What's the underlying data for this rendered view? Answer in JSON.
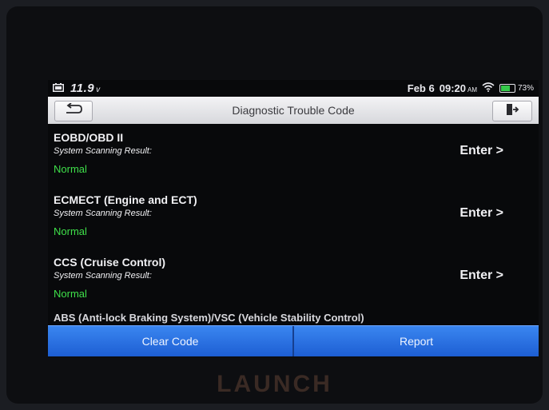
{
  "status": {
    "voltage": "11.9",
    "voltage_unit": "v",
    "date": "Feb 6",
    "time": "09:20",
    "ampm": "AM",
    "battery_pct": "73%",
    "battery_level": 0.73
  },
  "title_bar": {
    "title": "Diagnostic Trouble Code",
    "back_icon": "back-arrow-icon",
    "exit_icon": "exit-door-icon"
  },
  "systems": [
    {
      "name": "EOBD/OBD II",
      "subtitle": "System Scanning Result:",
      "result": "Normal",
      "action": "Enter >"
    },
    {
      "name": "ECMECT (Engine and ECT)",
      "subtitle": "System Scanning Result:",
      "result": "Normal",
      "action": "Enter >"
    },
    {
      "name": "CCS (Cruise Control)",
      "subtitle": "System Scanning Result:",
      "result": "Normal",
      "action": "Enter >"
    }
  ],
  "partial_row": "ABS (Anti-lock Braking System)/VSC (Vehicle Stability Control)",
  "bottom_bar": {
    "clear_code": "Clear Code",
    "report": "Report"
  },
  "brand": "LAUNCH",
  "colors": {
    "accent_blue": "#2f78e6",
    "result_green": "#3fe04a",
    "battery_green": "#35c94a"
  }
}
